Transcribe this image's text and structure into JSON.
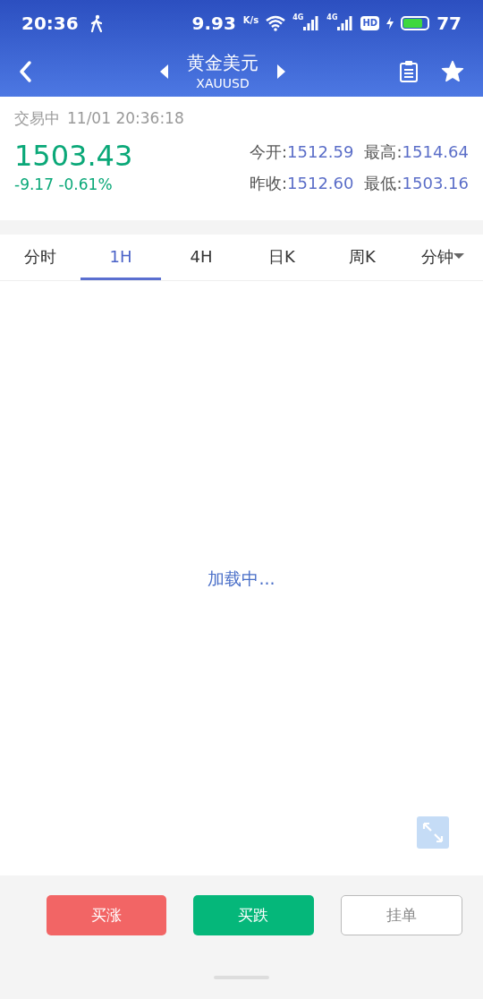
{
  "status_bar": {
    "time": "20:36",
    "speed": "9.93",
    "speed_unit": "K/s",
    "signals": [
      {
        "label": "4G"
      },
      {
        "label": "4G"
      }
    ],
    "hd": "HD",
    "battery": "77"
  },
  "header": {
    "title": "黄金美元",
    "subtitle": "XAUUSD"
  },
  "quote": {
    "status": "交易中",
    "datetime": "11/01 20:36:18",
    "price": "1503.43",
    "change": "-9.17 -0.61%",
    "stats": [
      {
        "label": "今开:",
        "value": "1512.59"
      },
      {
        "label": "最高:",
        "value": "1514.64"
      },
      {
        "label": "昨收:",
        "value": "1512.60"
      },
      {
        "label": "最低:",
        "value": "1503.16"
      }
    ]
  },
  "tabs": [
    {
      "label": "分时",
      "selected": false,
      "kind": "plain"
    },
    {
      "label": "1H",
      "selected": true,
      "kind": "plain"
    },
    {
      "label": "4H",
      "selected": false,
      "kind": "plain"
    },
    {
      "label": "日K",
      "selected": false,
      "kind": "plain"
    },
    {
      "label": "周K",
      "selected": false,
      "kind": "plain"
    },
    {
      "label": "分钟",
      "selected": false,
      "kind": "dropdown"
    }
  ],
  "chart": {
    "loading": "加载中..."
  },
  "actions": [
    {
      "label": "买涨",
      "kind": "up"
    },
    {
      "label": "买跌",
      "kind": "down"
    },
    {
      "label": "挂单",
      "kind": "pending"
    }
  ]
}
